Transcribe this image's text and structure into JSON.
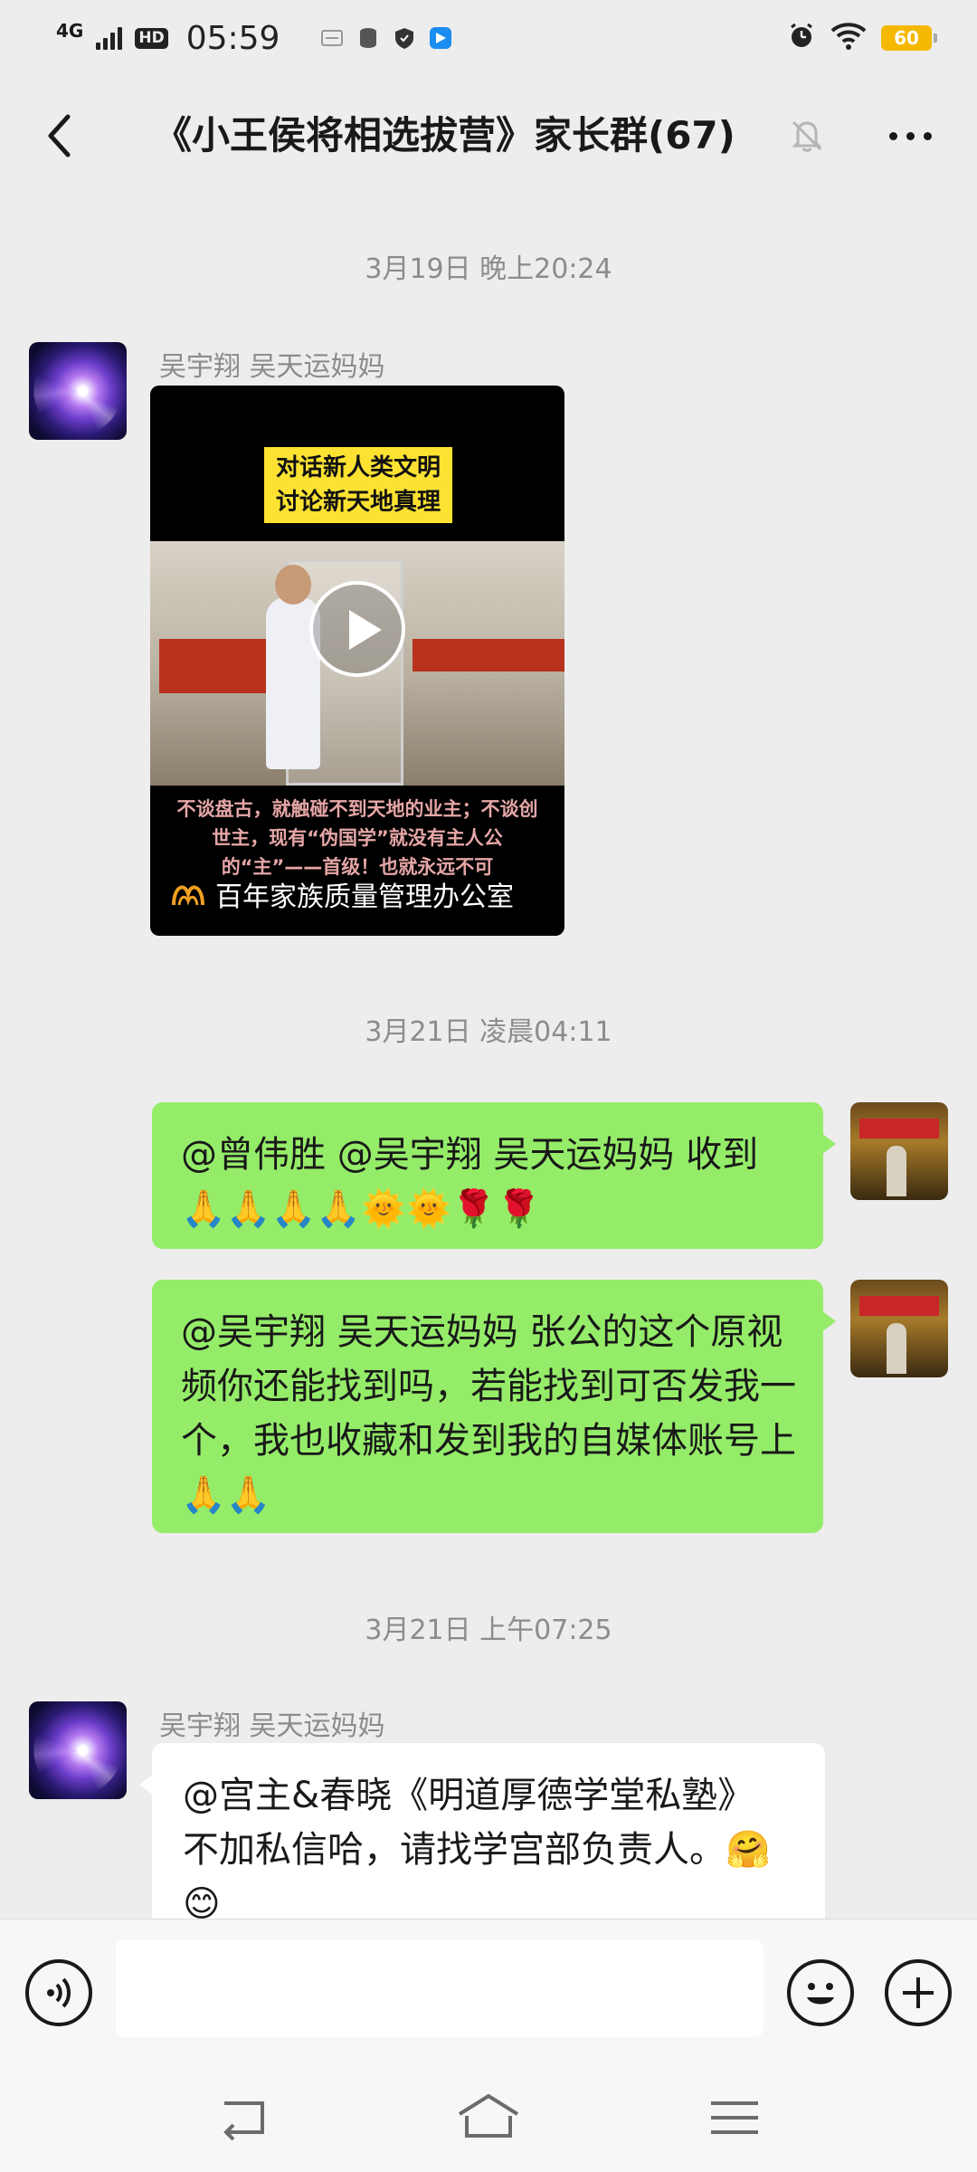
{
  "status_bar": {
    "network": "4G",
    "hd": "HD",
    "time": "05:59",
    "battery": "60"
  },
  "header": {
    "title": "《小王侯将相选拔营》家长群(67)",
    "back_icon": "chevron-left-icon",
    "mute_icon": "bell-off-icon",
    "more_icon": "more-horizontal-icon"
  },
  "messages": [
    {
      "type": "timestamp",
      "text": "3月19日 晚上20:24"
    },
    {
      "type": "video",
      "sender": "吴宇翔 吴天运妈妈",
      "caption_top_line1": "对话新人类文明",
      "caption_top_line2": "讨论新天地真理",
      "caption_bottom": "不谈盘古，就触碰不到天地的业主；不谈创世主，现有“伪国学”就没有主人公的“主”——首级！也就永远不可",
      "source": "百年家族质量管理办公室"
    },
    {
      "type": "timestamp",
      "text": "3月21日 凌晨04:11"
    },
    {
      "type": "text",
      "from": "me",
      "text": "@曾伟胜 @吴宇翔 吴天运妈妈  收到🙏🙏🙏🙏🌞🌞🌹🌹"
    },
    {
      "type": "text",
      "from": "me",
      "text": "@吴宇翔 吴天运妈妈  张公的这个原视频你还能找到吗，若能找到可否发我一个，我也收藏和发到我的自媒体账号上🙏🙏"
    },
    {
      "type": "timestamp",
      "text": "3月21日 上午07:25"
    },
    {
      "type": "text",
      "from": "other",
      "sender": "吴宇翔 吴天运妈妈",
      "text": "@宫主&春晓《明道厚德学堂私塾》 不加私信哈，请找学宫部负责人。🤗😊"
    }
  ],
  "input_bar": {
    "value": "",
    "voice_icon": "voice-icon",
    "emoji_icon": "emoji-icon",
    "plus_icon": "plus-icon"
  },
  "nav_bar": {
    "back_icon": "nav-back-icon",
    "home_icon": "nav-home-icon",
    "menu_icon": "nav-menu-icon"
  },
  "colors": {
    "background": "#ededed",
    "my_bubble": "#95ec69",
    "other_bubble": "#ffffff",
    "timestamp_text": "#8c8c8c",
    "battery": "#f5b800"
  }
}
